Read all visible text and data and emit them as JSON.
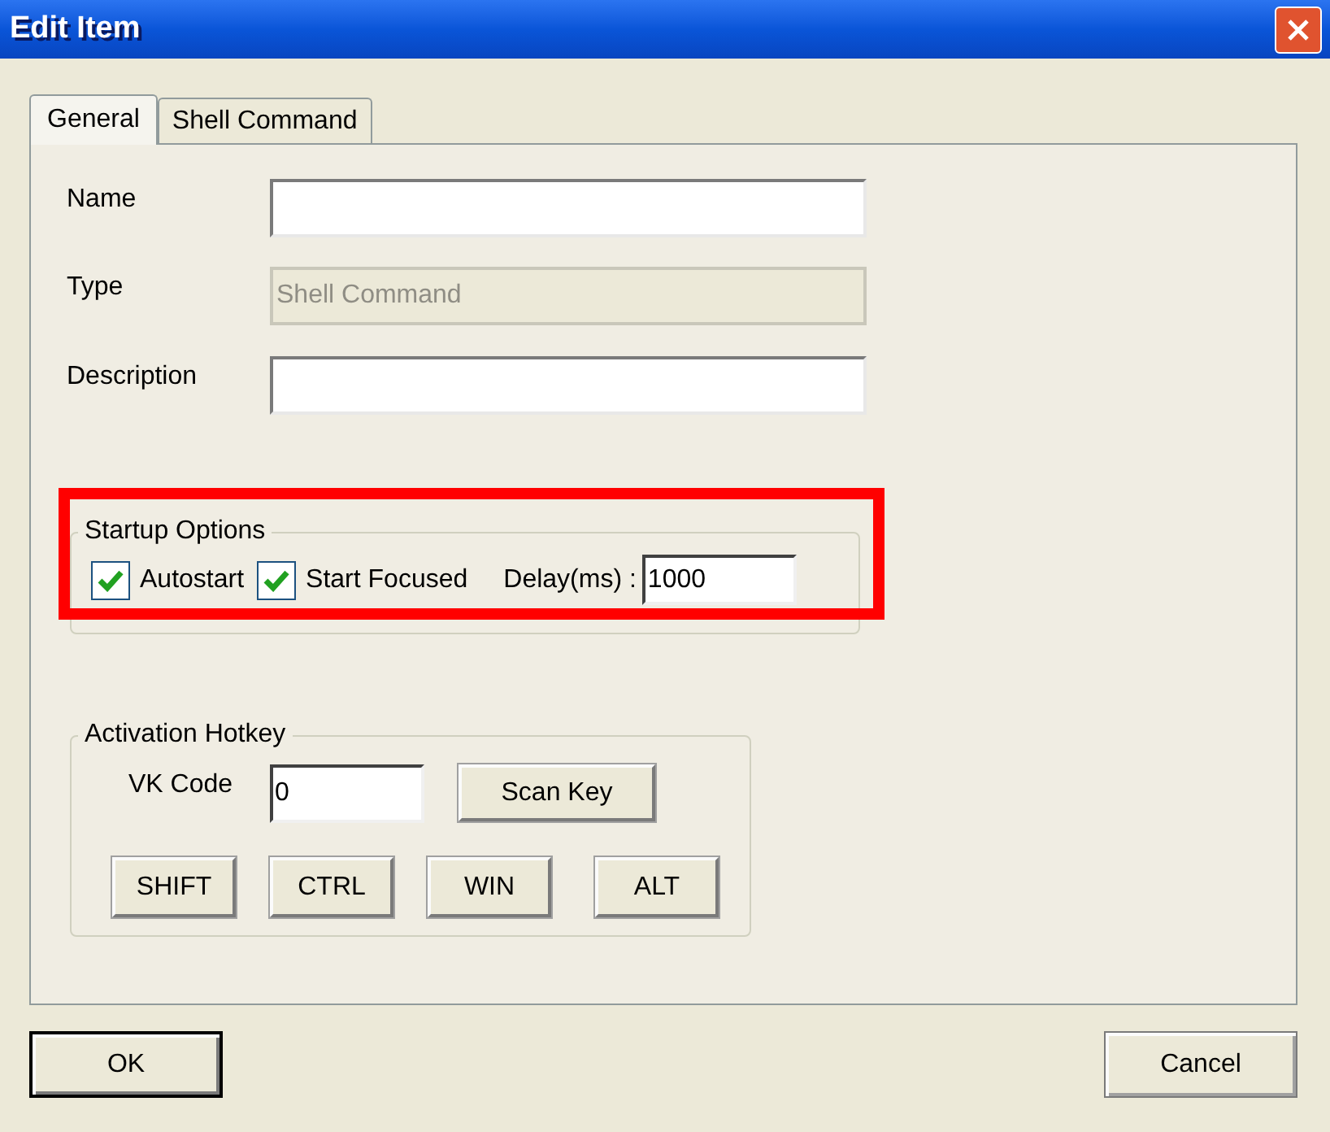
{
  "window": {
    "title": "Edit Item"
  },
  "tabs": [
    {
      "label": "General",
      "selected": true
    },
    {
      "label": "Shell Command",
      "selected": false
    }
  ],
  "fields": [
    {
      "label": "Name",
      "disabled": false
    },
    {
      "label": "Type",
      "value": "Shell Command",
      "disabled": true
    },
    {
      "label": "Description",
      "disabled": false
    }
  ],
  "startup_options": {
    "title": "Startup Options",
    "highlighted": true,
    "checkboxes": [
      {
        "label": "Autostart",
        "checked": true
      },
      {
        "label": "Start Focused",
        "checked": true
      }
    ],
    "delay_label": "Delay(ms) :",
    "delay_value": "1000"
  },
  "activation_hotkey": {
    "title": "Activation Hotkey",
    "vk_label": "VK Code",
    "vk_value": "0",
    "scan_button": "Scan Key",
    "modifiers": [
      "SHIFT",
      "CTRL",
      "WIN",
      "ALT"
    ]
  },
  "buttons": [
    {
      "label": "OK",
      "default": true
    },
    {
      "label": "Cancel",
      "default": false
    }
  ]
}
